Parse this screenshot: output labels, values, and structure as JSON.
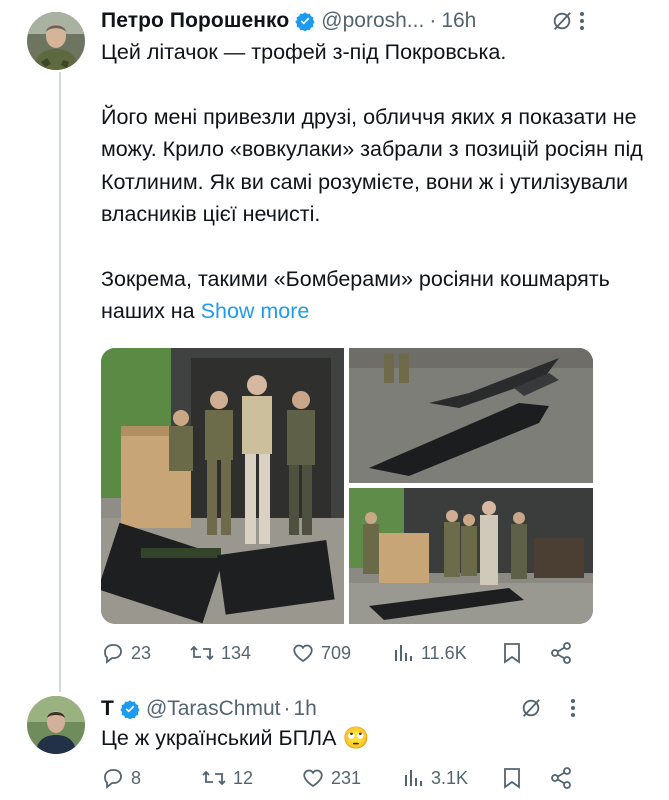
{
  "tweet1": {
    "name": "Петро Порошенко",
    "handle": "@porosh...",
    "dot": "·",
    "time": "16h",
    "paragraphs": [
      "Цей літачок — трофей з-під Покровська.",
      "Його мені привезли друзі, обличчя яких я показати не можу. Крило «вовкулаки» забрали з позицій росіян під Котлиним. Як ви самі розумієте, вони ж і утилізували власників цієї нечисті."
    ],
    "last_paragraph": "Зокрема, такими «Бомберами» росіяни кошмарять наших на",
    "show_more": "Show more",
    "replies": "23",
    "reposts": "134",
    "likes": "709",
    "views": "11.6K"
  },
  "tweet2": {
    "name": "T",
    "handle": "@TarasChmut",
    "dot": "·",
    "time": "1h",
    "text": "Це ж український БПЛА",
    "emoji": "🙄",
    "replies": "8",
    "reposts": "12",
    "likes": "231",
    "views": "3.1K"
  },
  "colors": {
    "accent": "#1d9bf0",
    "muted": "#536471",
    "text": "#0f1419"
  },
  "icons": [
    "verified-badge-icon",
    "grok-icon",
    "more-icon",
    "reply-icon",
    "repost-icon",
    "like-icon",
    "views-icon",
    "bookmark-icon",
    "share-icon"
  ]
}
